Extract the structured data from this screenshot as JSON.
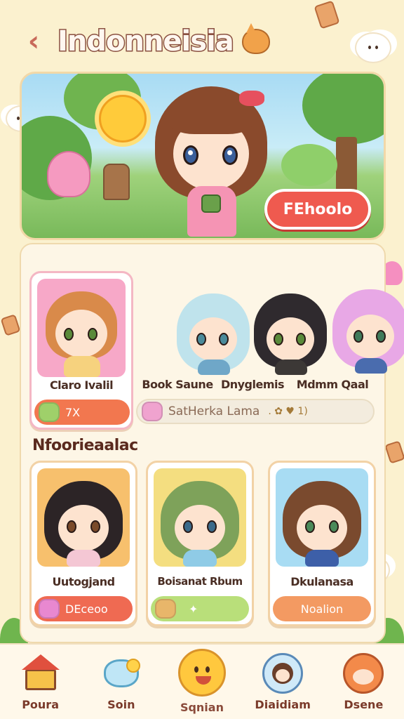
{
  "header": {
    "title": "Indonneisia"
  },
  "hero": {
    "cta_label": "FEhoolo"
  },
  "featured": {
    "name": "Claro Ivalil",
    "badge_text": "7X"
  },
  "group": {
    "names": [
      "Book Saune",
      "Dnyglemis",
      "Mdmm Qaal"
    ],
    "info_text": "SatHerka Lama",
    "extra": ". ✿ ♥ 1)"
  },
  "section": {
    "title": "Nfoorieaalac"
  },
  "characters": [
    {
      "name": "Uutogjand",
      "button_label": "DEceoo",
      "card_color": "#f7c06d",
      "btn_color": "#ef6a52"
    },
    {
      "name": "Boisanat Rbum",
      "button_label": "",
      "card_color": "#f4de80",
      "btn_color": "#b9df7a"
    },
    {
      "name": "Dkulanasa",
      "button_label": "Noalion",
      "card_color": "#a8dcf3",
      "btn_color": "#f39a62"
    }
  ],
  "nav": {
    "items": [
      {
        "label": "Poura",
        "icon": "house-icon"
      },
      {
        "label": "Soin",
        "icon": "cloud-icon"
      },
      {
        "label": "Sqnian",
        "icon": "smiley-icon"
      },
      {
        "label": "Diaidiam",
        "icon": "profile-icon"
      },
      {
        "label": "Dsene",
        "icon": "fox-icon"
      }
    ]
  },
  "colors": {
    "background": "#fbf1cf",
    "accent": "#ef5a4f",
    "title_stroke": "#8a5040"
  }
}
